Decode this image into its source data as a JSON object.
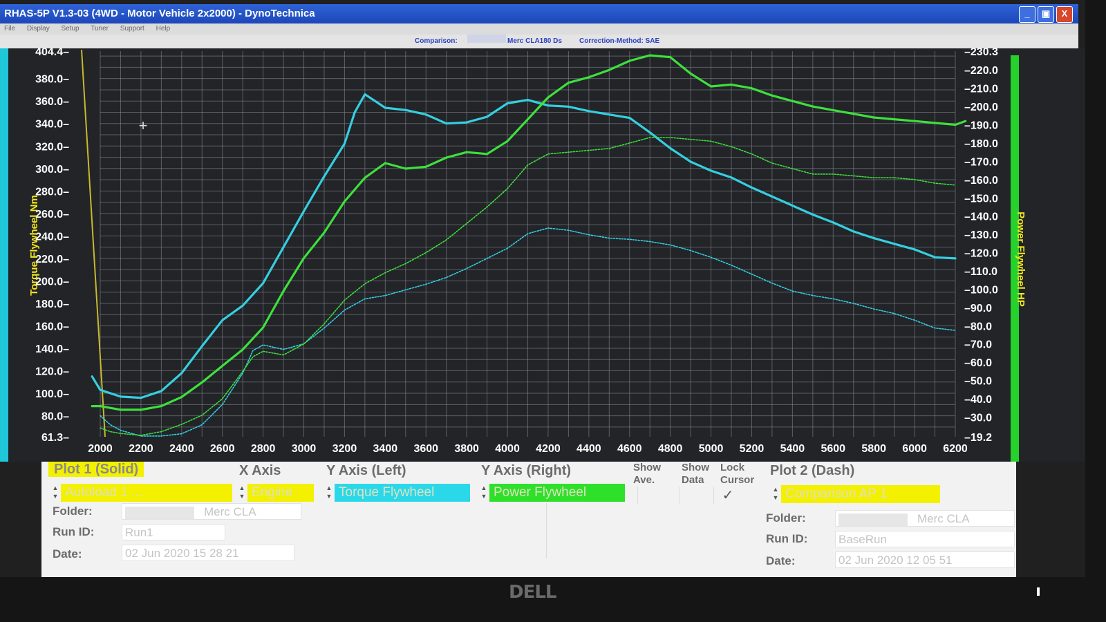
{
  "window": {
    "title": "RHAS-5P V1.3-03  (4WD - Motor Vehicle 2x2000) - DynoTechnica",
    "menu": [
      "File",
      "Display",
      "Setup",
      "Tuner",
      "Support",
      "Help"
    ],
    "buttons": [
      "_",
      "▣",
      "X"
    ]
  },
  "info": {
    "comparison_label": "Comparison:",
    "vehicle": "Merc CLA180 Ds",
    "correction": "Correction-Method: SAE"
  },
  "colors": {
    "plot_bg": "#222428",
    "grid": "#8a8f96",
    "torque": "#35cfe0",
    "power": "#3ee03c",
    "axis_label": "#f4e61c",
    "tick_text": "#ffffff",
    "edge_left": "#1fc7d8",
    "edge_right": "#25d12a"
  },
  "chart_data": {
    "type": "line",
    "xlabel": "",
    "ylabel_left": "Torque Flywheel Nm",
    "ylabel_right": "Power Flywheel HP",
    "xlim": [
      2000,
      6200
    ],
    "ylim_left": [
      61.3,
      404.4
    ],
    "ylim_right": [
      19.2,
      230.3
    ],
    "x_ticks": [
      "2000",
      "2200",
      "2400",
      "2600",
      "2800",
      "3000",
      "3200",
      "3400",
      "3600",
      "3800",
      "4000",
      "4200",
      "4400",
      "4600",
      "4800",
      "5000",
      "5200",
      "5400",
      "5600",
      "5800",
      "6000",
      "6200"
    ],
    "y_left_ticks": [
      "404.4",
      "380.0",
      "360.0",
      "340.0",
      "320.0",
      "300.0",
      "280.0",
      "260.0",
      "240.0",
      "220.0",
      "200.0",
      "180.0",
      "160.0",
      "140.0",
      "120.0",
      "100.0",
      "80.0",
      "61.3"
    ],
    "y_right_ticks": [
      "230.3",
      "220.0",
      "210.0",
      "200.0",
      "190.0",
      "180.0",
      "170.0",
      "160.0",
      "150.0",
      "140.0",
      "130.0",
      "120.0",
      "110.0",
      "100.0",
      "90.0",
      "80.0",
      "70.0",
      "60.0",
      "50.0",
      "40.0",
      "30.0",
      "19.2"
    ],
    "grid": true,
    "legend": "bottom panel",
    "series": [
      {
        "name": "Torque Flywheel",
        "axis": "left",
        "style": "solid",
        "x": [
          1960,
          2000,
          2100,
          2200,
          2300,
          2400,
          2500,
          2600,
          2700,
          2800,
          2900,
          3000,
          3100,
          3200,
          3250,
          3300,
          3350,
          3400,
          3500,
          3600,
          3700,
          3800,
          3900,
          4000,
          4100,
          4200,
          4300,
          4400,
          4500,
          4600,
          4700,
          4800,
          4900,
          5000,
          5100,
          5200,
          5300,
          5400,
          5500,
          5600,
          5700,
          5800,
          5900,
          6000,
          6100,
          6200
        ],
        "y": [
          115,
          103,
          97,
          96,
          102,
          118,
          142,
          165,
          178,
          198,
          230,
          262,
          293,
          322,
          350,
          366,
          360,
          354,
          352,
          348,
          340,
          341,
          346,
          358,
          361,
          356,
          355,
          351,
          348,
          345,
          332,
          318,
          306,
          298,
          292,
          283,
          275,
          267,
          259,
          252,
          244,
          238,
          233,
          228,
          221,
          220
        ]
      },
      {
        "name": "Power Flywheel",
        "axis": "right",
        "style": "solid",
        "x": [
          1960,
          2000,
          2100,
          2200,
          2300,
          2400,
          2500,
          2600,
          2700,
          2800,
          2900,
          3000,
          3100,
          3200,
          3300,
          3400,
          3500,
          3600,
          3700,
          3800,
          3900,
          4000,
          4100,
          4200,
          4300,
          4400,
          4500,
          4600,
          4700,
          4800,
          4900,
          5000,
          5100,
          5200,
          5300,
          5400,
          5500,
          5600,
          5700,
          5800,
          5900,
          6000,
          6100,
          6200,
          6250
        ],
        "y": [
          36,
          36,
          34,
          34,
          36,
          41,
          49,
          58,
          67,
          79,
          99,
          117,
          131,
          148,
          161,
          169,
          166,
          167,
          172,
          175,
          174,
          181,
          193,
          205,
          213,
          216,
          220,
          225,
          228,
          227,
          218,
          211,
          212,
          210,
          206,
          203,
          200,
          198,
          196,
          194,
          193,
          192,
          191,
          190,
          192
        ]
      },
      {
        "name": "Comparison Torque Flywheel",
        "axis": "left",
        "style": "dash",
        "x": [
          2000,
          2050,
          2100,
          2200,
          2300,
          2400,
          2500,
          2600,
          2700,
          2750,
          2800,
          2900,
          3000,
          3100,
          3200,
          3300,
          3400,
          3500,
          3600,
          3700,
          3800,
          3900,
          4000,
          4100,
          4200,
          4300,
          4400,
          4500,
          4600,
          4700,
          4800,
          4900,
          5000,
          5100,
          5200,
          5300,
          5400,
          5500,
          5600,
          5700,
          5800,
          5900,
          6000,
          6100,
          6200
        ],
        "y": [
          80,
          72,
          67,
          62,
          62,
          64,
          72,
          90,
          118,
          138,
          143,
          139,
          144,
          158,
          174,
          184,
          187,
          192,
          197,
          203,
          211,
          220,
          229,
          242,
          247,
          245,
          241,
          238,
          237,
          235,
          232,
          227,
          221,
          214,
          206,
          198,
          191,
          187,
          184,
          180,
          175,
          171,
          165,
          158,
          156
        ]
      },
      {
        "name": "Comparison Power Flywheel",
        "axis": "right",
        "style": "dash",
        "x": [
          2000,
          2050,
          2100,
          2200,
          2300,
          2400,
          2500,
          2600,
          2700,
          2750,
          2800,
          2900,
          3000,
          3100,
          3200,
          3300,
          3400,
          3500,
          3600,
          3700,
          3800,
          3900,
          4000,
          4100,
          4200,
          4300,
          4400,
          4500,
          4600,
          4700,
          4800,
          4900,
          5000,
          5100,
          5200,
          5300,
          5400,
          5500,
          5600,
          5700,
          5800,
          5900,
          6000,
          6100,
          6200
        ],
        "y": [
          24,
          22,
          21,
          20,
          22,
          26,
          31,
          40,
          55,
          63,
          66,
          64,
          70,
          81,
          94,
          103,
          109,
          114,
          120,
          127,
          136,
          145,
          155,
          168,
          174,
          175,
          176,
          177,
          180,
          183,
          183,
          182,
          181,
          178,
          174,
          169,
          166,
          163,
          163,
          162,
          161,
          161,
          160,
          158,
          157
        ]
      }
    ]
  },
  "panel": {
    "plot1_title": "Plot 1 (Solid)",
    "x_axis_title": "X Axis",
    "y_left_title": "Y Axis (Left)",
    "y_right_title": "Y Axis (Right)",
    "show_ave_title": "Show Ave.",
    "show_data_title": "Show Data",
    "lock_cursor_title": "Lock Cursor",
    "plot2_title": "Plot 2 (Dash)",
    "plot1_run": "Autoload 1 ...",
    "x_axis_value": "Engine",
    "y_left_value": "Torque Flywheel",
    "y_right_value": "Power Flywheel",
    "lock_cursor_check": "✓",
    "plot2_run": "Comparison AP 1",
    "folder_label": "Folder:",
    "runid_label": "Run ID:",
    "date_label": "Date:",
    "plot1_folder": "Merc CLA",
    "plot1_runid": "Run1",
    "plot1_date": "02 Jun 2020  15 28 21",
    "plot2_folder": "Merc CLA",
    "plot2_runid": "BaseRun",
    "plot2_date": "02 Jun 2020  12 05 51"
  },
  "monitor": {
    "brand": "DELL"
  }
}
